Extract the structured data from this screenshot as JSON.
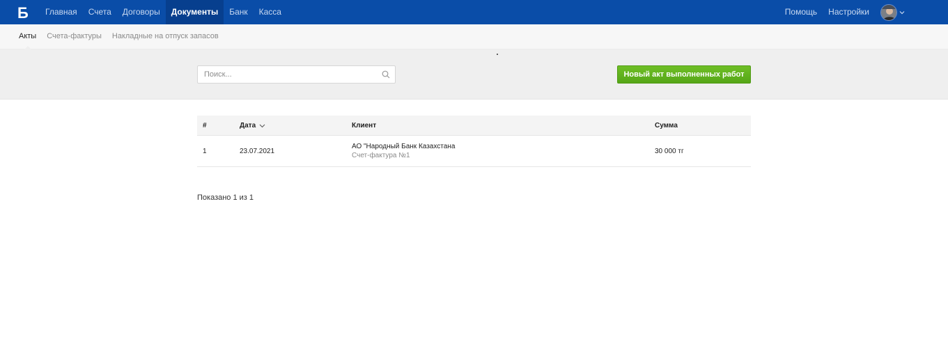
{
  "nav": {
    "logo_glyph": "Б",
    "items": [
      {
        "label": "Главная"
      },
      {
        "label": "Счета"
      },
      {
        "label": "Договоры"
      },
      {
        "label": "Документы"
      },
      {
        "label": "Банк"
      },
      {
        "label": "Касса"
      }
    ],
    "active_index": 3,
    "right": {
      "help": "Помощь",
      "settings": "Настройки"
    }
  },
  "subnav": {
    "items": [
      {
        "label": "Акты"
      },
      {
        "label": "Счета-фактуры"
      },
      {
        "label": "Накладные на отпуск запасов"
      }
    ],
    "active_index": 0
  },
  "toolbar": {
    "search_placeholder": "Поиск...",
    "search_value": "",
    "new_button_label": "Новый акт выполненных работ"
  },
  "table": {
    "columns": {
      "num": "#",
      "date": "Дата",
      "client": "Клиент",
      "amount": "Сумма"
    },
    "rows": [
      {
        "num": "1",
        "date": "23.07.2021",
        "client": "АО \"Народный Банк Казахстана",
        "client_sub": "Счет-фактура №1",
        "amount": "30 000 тг"
      }
    ]
  },
  "pager": {
    "text": "Показано 1 из 1"
  },
  "colors": {
    "header_bg": "#0a4da8",
    "header_active_bg": "#073f8e",
    "button_green": "#5fb01d"
  }
}
